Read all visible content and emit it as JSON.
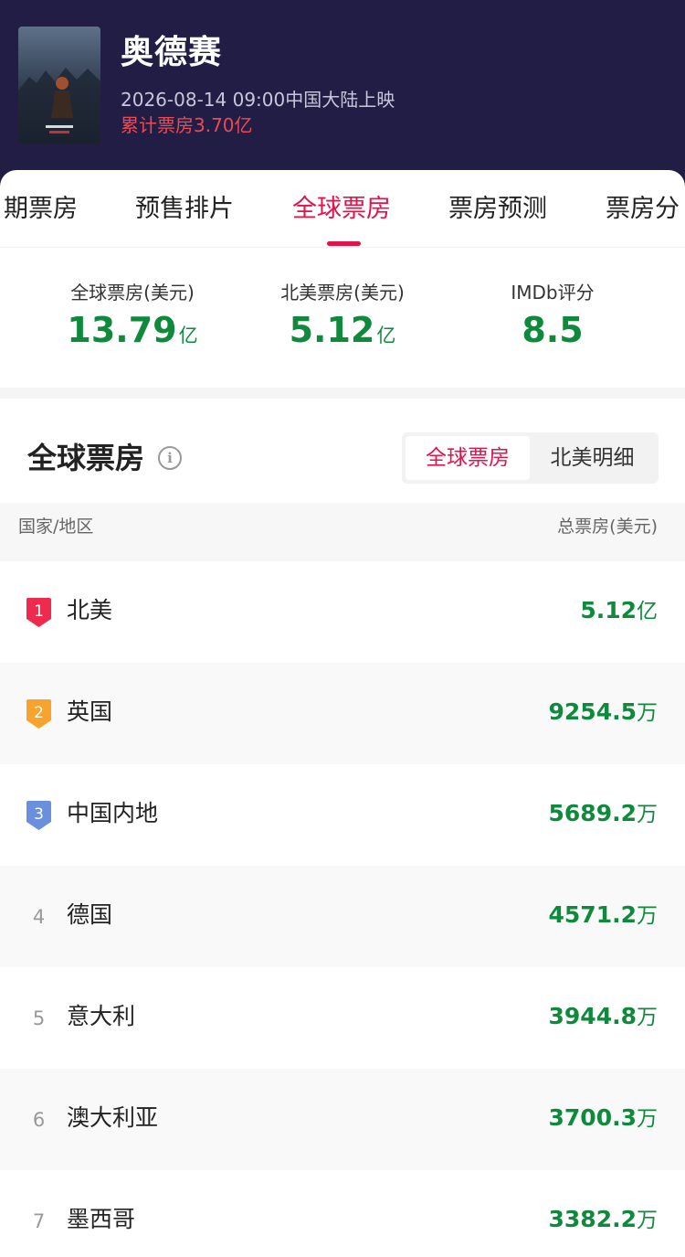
{
  "header": {
    "title": "奥德赛",
    "release": "2026-08-14 09:00中国大陆上映",
    "cumulative": "累计票房3.70亿"
  },
  "tabs": [
    {
      "label": "期票房",
      "active": false
    },
    {
      "label": "预售排片",
      "active": false
    },
    {
      "label": "全球票房",
      "active": true
    },
    {
      "label": "票房预测",
      "active": false
    },
    {
      "label": "票房分",
      "active": false
    }
  ],
  "stats": [
    {
      "label": "全球票房(美元)",
      "value": "13.79",
      "unit": "亿"
    },
    {
      "label": "北美票房(美元)",
      "value": "5.12",
      "unit": "亿"
    },
    {
      "label": "IMDb评分",
      "value": "8.5",
      "unit": ""
    }
  ],
  "section": {
    "title": "全球票房",
    "segment": [
      {
        "label": "全球票房",
        "active": true
      },
      {
        "label": "北美明细",
        "active": false
      }
    ]
  },
  "table": {
    "col_country": "国家/地区",
    "col_gross": "总票房(美元)",
    "rows": [
      {
        "rank": "1",
        "country": "北美",
        "amount": "5.12",
        "unit": "亿",
        "badge_color": "#ee2a4f"
      },
      {
        "rank": "2",
        "country": "英国",
        "amount": "9254.5",
        "unit": "万",
        "badge_color": "#f7a42e"
      },
      {
        "rank": "3",
        "country": "中国内地",
        "amount": "5689.2",
        "unit": "万",
        "badge_color": "#6a8fdc"
      },
      {
        "rank": "4",
        "country": "德国",
        "amount": "4571.2",
        "unit": "万"
      },
      {
        "rank": "5",
        "country": "意大利",
        "amount": "3944.8",
        "unit": "万"
      },
      {
        "rank": "6",
        "country": "澳大利亚",
        "amount": "3700.3",
        "unit": "万"
      },
      {
        "rank": "7",
        "country": "墨西哥",
        "amount": "3382.2",
        "unit": "万"
      }
    ]
  }
}
